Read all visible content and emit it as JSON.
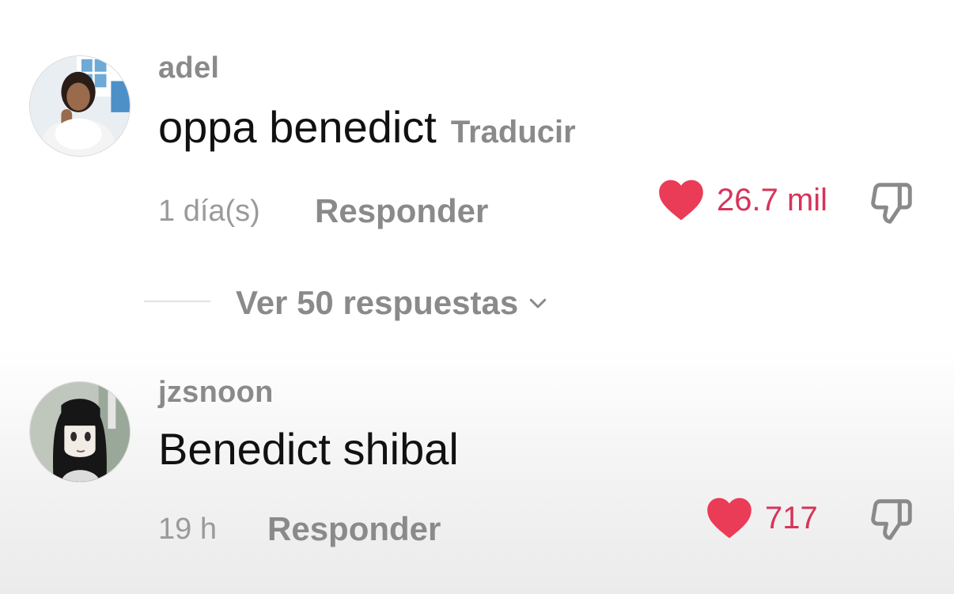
{
  "comments": [
    {
      "username": "adel",
      "text": "oppa benedict",
      "translate_label": "Traducir",
      "time": "1 día(s)",
      "reply_label": "Responder",
      "likes": "26.7 mil",
      "liked": true
    },
    {
      "username": "jzsnoon",
      "text": "Benedict shibal",
      "time": "19 h",
      "reply_label": "Responder",
      "likes": "717",
      "liked": true
    }
  ],
  "view_replies": {
    "label": "Ver 50 respuestas"
  },
  "icons": {
    "like": "heart-icon",
    "dislike": "thumbs-down-icon",
    "expand": "chevron-down-icon"
  },
  "colors": {
    "like_accent": "#ea3b57",
    "like_count": "#d6345a",
    "secondary_text": "#8a8a8a",
    "primary_text": "#111111"
  }
}
